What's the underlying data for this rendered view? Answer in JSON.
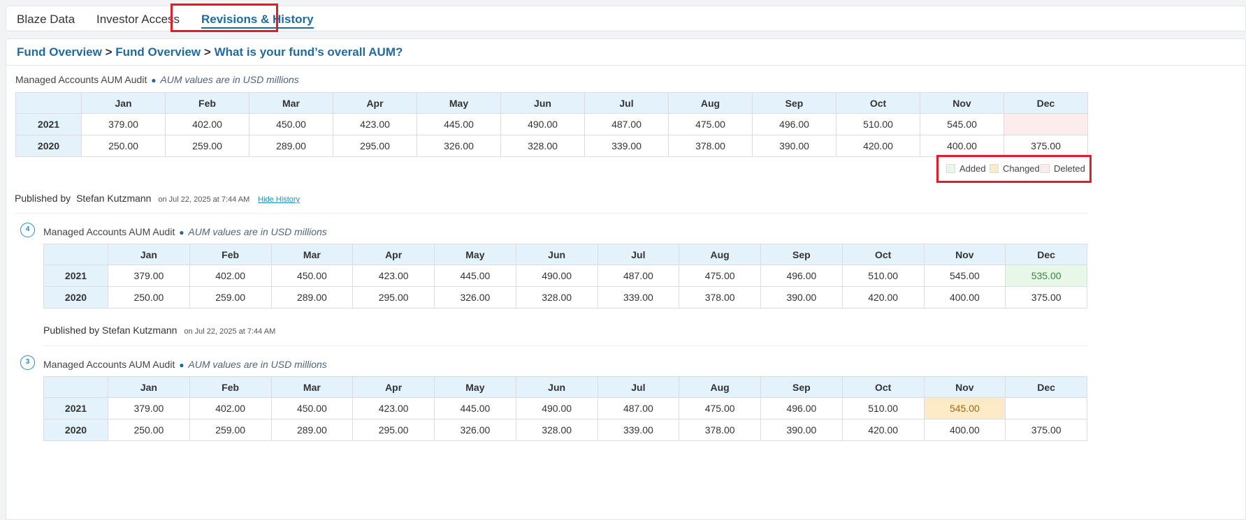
{
  "tabs": [
    {
      "label": "Blaze Data",
      "active": false
    },
    {
      "label": "Investor Access",
      "active": false
    },
    {
      "label": "Revisions & History",
      "active": true
    }
  ],
  "breadcrumb": {
    "items": [
      "Fund Overview",
      "Fund Overview"
    ],
    "separator": ">",
    "current": "What is your fund’s overall AUM?"
  },
  "current_table": {
    "title": "Managed Accounts AUM Audit",
    "bullet": "●",
    "note": "AUM values are in USD millions",
    "months": [
      "Jan",
      "Feb",
      "Mar",
      "Apr",
      "May",
      "Jun",
      "Jul",
      "Aug",
      "Sep",
      "Oct",
      "Nov",
      "Dec"
    ],
    "rows": [
      {
        "year": "2021",
        "values": [
          "379.00",
          "402.00",
          "450.00",
          "423.00",
          "445.00",
          "490.00",
          "487.00",
          "475.00",
          "496.00",
          "510.00",
          "545.00",
          ""
        ]
      },
      {
        "year": "2020",
        "values": [
          "250.00",
          "259.00",
          "289.00",
          "295.00",
          "326.00",
          "328.00",
          "339.00",
          "378.00",
          "390.00",
          "420.00",
          "400.00",
          "375.00"
        ]
      }
    ]
  },
  "legend": {
    "items": [
      {
        "label": "Added",
        "color": "#e8f8e8"
      },
      {
        "label": "Changed",
        "color": "#fdebc8"
      },
      {
        "label": "Deleted",
        "color": "#fdecec"
      }
    ]
  },
  "published_main": {
    "prefix": "Published by",
    "author": "Stefan Kutzmann",
    "meta": "on Jul 22, 2025 at 7:44 AM",
    "hide_history": "Hide History"
  },
  "revisions": [
    {
      "version": "4",
      "title": "Managed Accounts AUM Audit",
      "note": "AUM values are in USD millions",
      "rows": [
        {
          "year": "2021",
          "values": [
            "379.00",
            "402.00",
            "450.00",
            "423.00",
            "445.00",
            "490.00",
            "487.00",
            "475.00",
            "496.00",
            "510.00",
            "545.00",
            "535.00"
          ]
        },
        {
          "year": "2020",
          "values": [
            "250.00",
            "259.00",
            "289.00",
            "295.00",
            "326.00",
            "328.00",
            "339.00",
            "378.00",
            "390.00",
            "420.00",
            "400.00",
            "375.00"
          ]
        }
      ],
      "published": {
        "prefix": "Published by Stefan Kutzmann",
        "meta": "on Jul 22, 2025 at 7:44 AM"
      }
    },
    {
      "version": "3",
      "title": "Managed Accounts AUM Audit",
      "note": "AUM values are in USD millions",
      "rows": [
        {
          "year": "2021",
          "values": [
            "379.00",
            "402.00",
            "450.00",
            "423.00",
            "445.00",
            "490.00",
            "487.00",
            "475.00",
            "496.00",
            "510.00",
            "545.00",
            ""
          ]
        },
        {
          "year": "2020",
          "values": [
            "250.00",
            "259.00",
            "289.00",
            "295.00",
            "326.00",
            "328.00",
            "339.00",
            "378.00",
            "390.00",
            "420.00",
            "400.00",
            "375.00"
          ]
        }
      ]
    }
  ],
  "colors": {
    "accent": "#1f6b9f",
    "highlight_box": "#e11d2a",
    "header_bg": "#e4f2fb"
  }
}
